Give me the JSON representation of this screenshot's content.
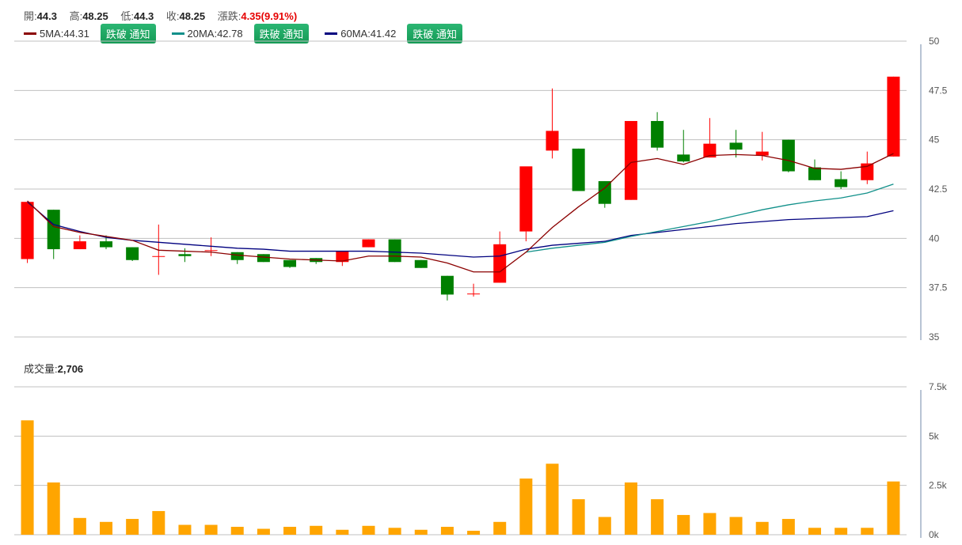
{
  "header": {
    "open_label": "開:",
    "open": "44.3",
    "high_label": "高:",
    "high": "48.25",
    "low_label": "低:",
    "low": "44.3",
    "close_label": "收:",
    "close": "48.25",
    "change_label": "漲跌:",
    "change": "4.35(9.91%)"
  },
  "ma_legend": [
    {
      "label": "5MA:44.31",
      "color": "#8b0000",
      "button": "跌破 通知"
    },
    {
      "label": "20MA:42.78",
      "color": "#11908a",
      "button": "跌破 通知"
    },
    {
      "label": "60MA:41.42",
      "color": "#00007f",
      "button": "跌破 通知"
    }
  ],
  "volume_header": {
    "label": "成交量:",
    "value": "2,706"
  },
  "colors": {
    "up": "#ff0000",
    "down": "#008000",
    "volume": "#ffa500",
    "grid": "#c0c0c0"
  },
  "chart_data": [
    {
      "type": "candlestick",
      "ylim": [
        35,
        50
      ],
      "yticks": [
        "50",
        "47.5",
        "45",
        "42.5",
        "40",
        "37.5",
        "35"
      ],
      "candles": [
        {
          "o": 38.95,
          "h": 40.1,
          "l": 38.75,
          "c": 41.85
        },
        {
          "o": 41.45,
          "h": 41.45,
          "l": 38.95,
          "c": 39.45
        },
        {
          "o": 39.45,
          "h": 40.15,
          "l": 39.45,
          "c": 39.85
        },
        {
          "o": 39.85,
          "h": 40.15,
          "l": 39.45,
          "c": 39.55
        },
        {
          "o": 39.55,
          "h": 39.55,
          "l": 38.85,
          "c": 38.9
        },
        {
          "o": 39.1,
          "h": 40.7,
          "l": 38.15,
          "c": 39.1
        },
        {
          "o": 39.2,
          "h": 39.5,
          "l": 38.8,
          "c": 39.1
        },
        {
          "o": 39.4,
          "h": 40.05,
          "l": 39.1,
          "c": 39.4
        },
        {
          "o": 39.3,
          "h": 39.3,
          "l": 38.7,
          "c": 38.9
        },
        {
          "o": 39.2,
          "h": 39.2,
          "l": 38.8,
          "c": 38.8
        },
        {
          "o": 38.9,
          "h": 38.9,
          "l": 38.5,
          "c": 38.55
        },
        {
          "o": 39.0,
          "h": 39.0,
          "l": 38.7,
          "c": 38.8
        },
        {
          "o": 38.8,
          "h": 39.3,
          "l": 38.6,
          "c": 39.35
        },
        {
          "o": 39.55,
          "h": 39.95,
          "l": 39.55,
          "c": 39.95
        },
        {
          "o": 39.95,
          "h": 39.95,
          "l": 38.8,
          "c": 38.8
        },
        {
          "o": 38.9,
          "h": 38.9,
          "l": 38.5,
          "c": 38.5
        },
        {
          "o": 38.1,
          "h": 38.1,
          "l": 36.85,
          "c": 37.15
        },
        {
          "o": 37.2,
          "h": 37.7,
          "l": 37.05,
          "c": 37.2
        },
        {
          "o": 37.75,
          "h": 40.35,
          "l": 37.75,
          "c": 39.7
        },
        {
          "o": 40.35,
          "h": 40.35,
          "l": 39.85,
          "c": 43.65
        },
        {
          "o": 44.45,
          "h": 47.6,
          "l": 44.05,
          "c": 45.45
        },
        {
          "o": 44.55,
          "h": 44.55,
          "l": 42.4,
          "c": 42.4
        },
        {
          "o": 42.9,
          "h": 42.9,
          "l": 41.55,
          "c": 41.75
        },
        {
          "o": 41.95,
          "h": 45.95,
          "l": 41.95,
          "c": 45.95
        },
        {
          "o": 45.95,
          "h": 46.4,
          "l": 44.45,
          "c": 44.6
        },
        {
          "o": 44.25,
          "h": 45.5,
          "l": 43.85,
          "c": 43.9
        },
        {
          "o": 44.1,
          "h": 46.1,
          "l": 44.1,
          "c": 44.8
        },
        {
          "o": 44.85,
          "h": 45.5,
          "l": 44.1,
          "c": 44.5
        },
        {
          "o": 44.2,
          "h": 45.4,
          "l": 43.95,
          "c": 44.4
        },
        {
          "o": 45.0,
          "h": 45.0,
          "l": 43.35,
          "c": 43.4
        },
        {
          "o": 43.6,
          "h": 44.0,
          "l": 42.95,
          "c": 42.95
        },
        {
          "o": 43.0,
          "h": 43.4,
          "l": 42.5,
          "c": 42.6
        },
        {
          "o": 42.95,
          "h": 44.4,
          "l": 42.75,
          "c": 43.8
        },
        {
          "o": 44.15,
          "h": 48.2,
          "l": 44.15,
          "c": 48.2
        }
      ],
      "ma5": [
        41.9,
        40.6,
        40.3,
        40.1,
        39.9,
        39.4,
        39.35,
        39.3,
        39.15,
        39.05,
        38.95,
        38.9,
        38.85,
        39.1,
        39.1,
        39.05,
        38.75,
        38.3,
        38.3,
        39.3,
        40.55,
        41.6,
        42.55,
        43.85,
        44.05,
        43.75,
        44.2,
        44.25,
        44.2,
        43.95,
        43.55,
        43.5,
        43.65,
        44.3
      ],
      "ma20": [
        null,
        null,
        null,
        null,
        null,
        null,
        null,
        null,
        null,
        null,
        null,
        null,
        null,
        null,
        null,
        null,
        null,
        null,
        null,
        39.3,
        39.5,
        39.65,
        39.8,
        40.1,
        40.35,
        40.6,
        40.85,
        41.15,
        41.45,
        41.7,
        41.9,
        42.05,
        42.3,
        42.75
      ],
      "ma60": [
        41.85,
        40.7,
        40.35,
        40.05,
        39.9,
        39.8,
        39.7,
        39.6,
        39.5,
        39.45,
        39.35,
        39.35,
        39.35,
        39.35,
        39.3,
        39.25,
        39.15,
        39.05,
        39.1,
        39.45,
        39.65,
        39.75,
        39.85,
        40.15,
        40.3,
        40.45,
        40.6,
        40.75,
        40.85,
        40.95,
        41.0,
        41.05,
        41.1,
        41.4
      ]
    },
    {
      "type": "bar",
      "ylim": [
        0,
        7500
      ],
      "yticks": [
        "7.5k",
        "5k",
        "2.5k",
        "0k"
      ],
      "values": [
        5800,
        2650,
        850,
        650,
        800,
        1200,
        500,
        500,
        400,
        300,
        400,
        450,
        250,
        450,
        350,
        250,
        400,
        200,
        650,
        2850,
        3600,
        1800,
        900,
        2650,
        1800,
        1000,
        1100,
        900,
        650,
        800,
        350,
        350,
        350,
        2700
      ]
    }
  ]
}
